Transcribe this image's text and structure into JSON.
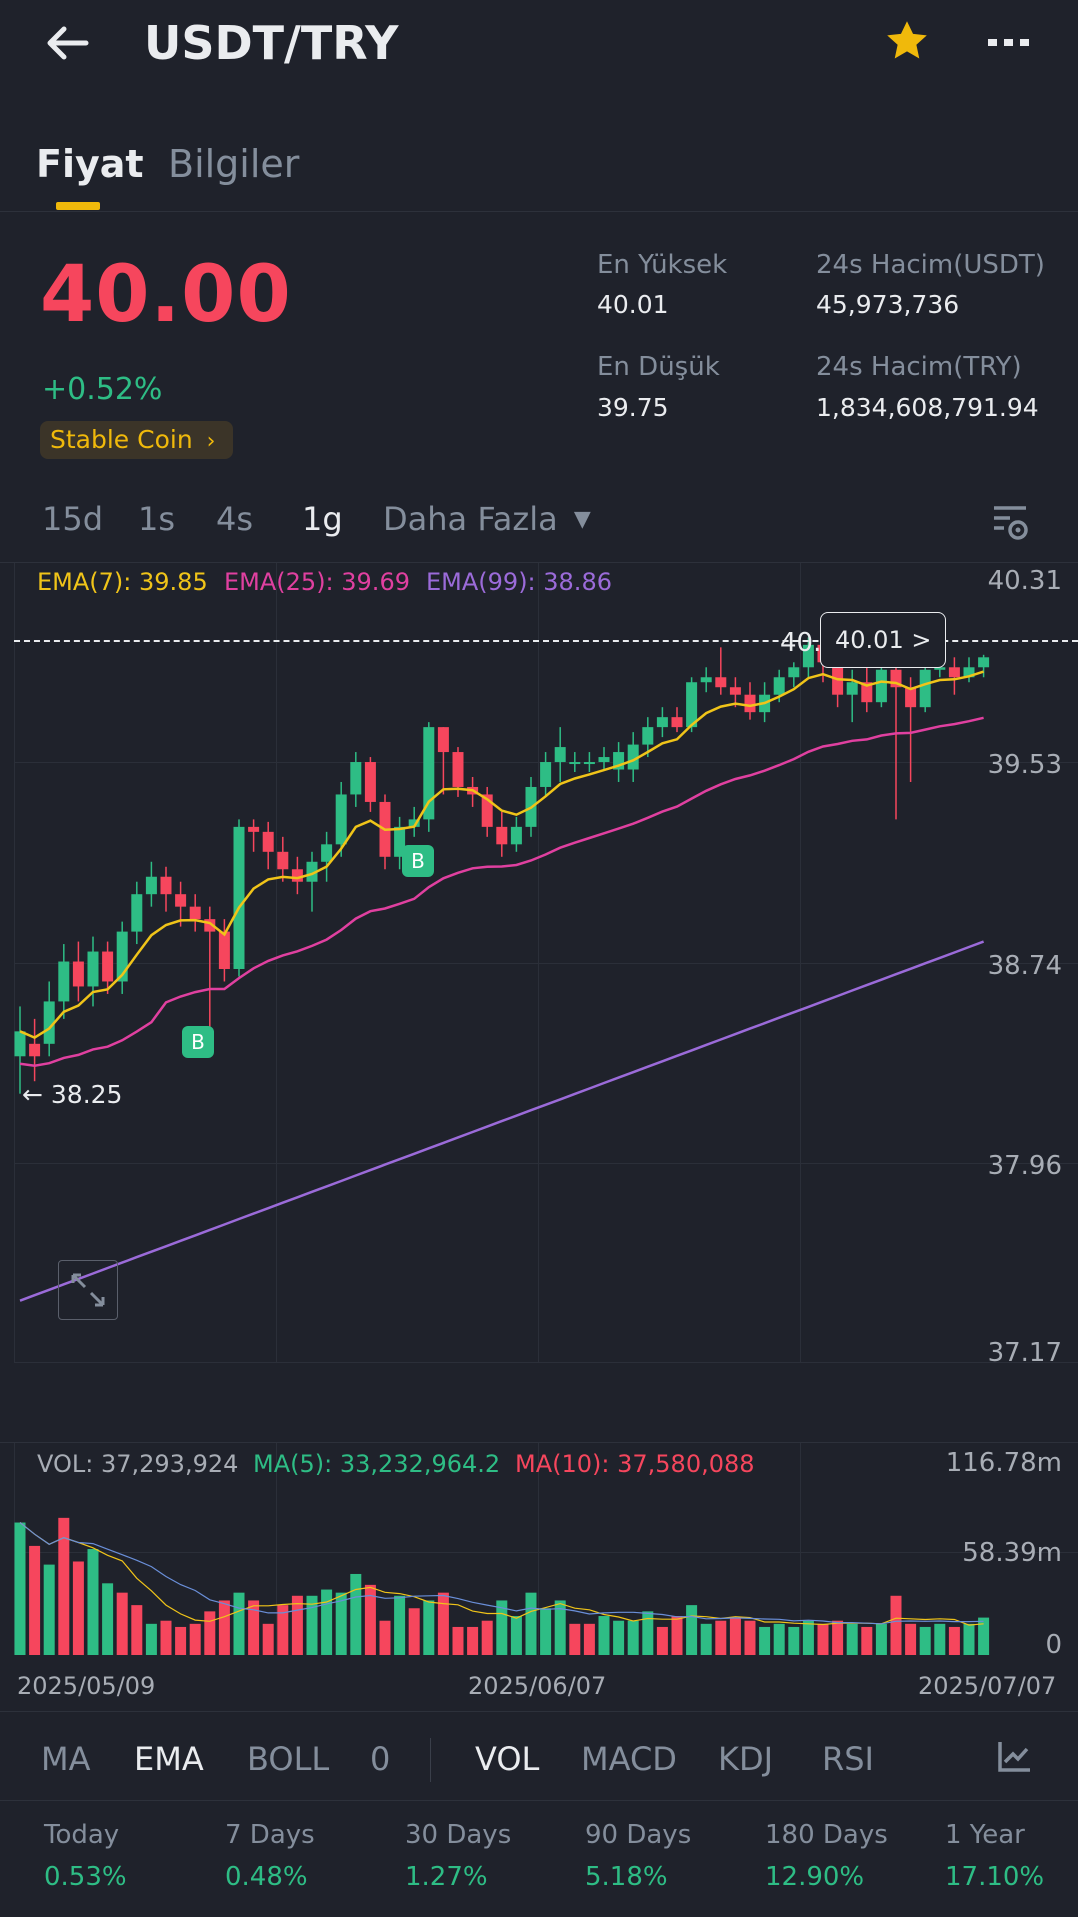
{
  "header": {
    "title": "USDT/TRY",
    "back_icon": "arrow-left-icon",
    "favorite_icon": "star-icon",
    "more_icon": "more-horizontal-icon",
    "favorite_color": "#f0b90b"
  },
  "tabs": [
    {
      "label": "Fiyat",
      "active": true
    },
    {
      "label": "Bilgiler",
      "active": false
    }
  ],
  "ticker": {
    "price": "40.00",
    "change": "+0.52%",
    "tag": "Stable Coin",
    "stats": {
      "high_label": "En Yüksek",
      "high": "40.01",
      "vol_usdt_label": "24s Hacim(USDT)",
      "vol_usdt": "45,973,736",
      "low_label": "En Düşük",
      "low": "39.75",
      "vol_try_label": "24s Hacim(TRY)",
      "vol_try": "1,834,608,791.94"
    }
  },
  "intervals": [
    {
      "label": "15d",
      "active": false
    },
    {
      "label": "1s",
      "active": false
    },
    {
      "label": "4s",
      "active": false
    },
    {
      "label": "1g",
      "active": true
    },
    {
      "label": "Daha Fazla",
      "active": false
    }
  ],
  "chart": {
    "ema7": "EMA(7): 39.85",
    "ema25": "EMA(25): 39.69",
    "ema99": "EMA(99): 38.86",
    "price_axis": [
      "40.31",
      "39.53",
      "38.74",
      "37.96",
      "37.17"
    ],
    "current_price_tag": "40.01 >",
    "current_price_partial": "40.",
    "low_marker": "← 38.25",
    "buy_marker": "B",
    "colors": {
      "up": "#2ebd85",
      "down": "#f6465d",
      "ema7": "#f0c419",
      "ema25": "#e040a0",
      "ema99": "#9b6bd9"
    }
  },
  "volume": {
    "vol": "VOL: 37,293,924",
    "ma5": "MA(5): 33,232,964.2",
    "ma10": "MA(10): 37,580,088",
    "axis": [
      "116.78m",
      "58.39m",
      "0"
    ]
  },
  "dates": [
    "2025/05/09",
    "2025/06/07",
    "2025/07/07"
  ],
  "indicators_main": [
    {
      "label": "MA",
      "active": false
    },
    {
      "label": "EMA",
      "active": true
    },
    {
      "label": "BOLL",
      "active": false
    },
    {
      "label": "0",
      "active": false
    }
  ],
  "indicators_sub": [
    {
      "label": "VOL",
      "active": true
    },
    {
      "label": "MACD",
      "active": false
    },
    {
      "label": "KDJ",
      "active": false
    },
    {
      "label": "RSI",
      "active": false
    }
  ],
  "performance": [
    {
      "label": "Today",
      "value": "0.53%"
    },
    {
      "label": "7 Days",
      "value": "0.48%"
    },
    {
      "label": "30 Days",
      "value": "1.27%"
    },
    {
      "label": "90 Days",
      "value": "5.18%"
    },
    {
      "label": "180 Days",
      "value": "12.90%"
    },
    {
      "label": "1 Year",
      "value": "17.10%"
    }
  ],
  "chart_data": {
    "type": "candlestick",
    "x_range": [
      "2025/05/09",
      "2025/07/07"
    ],
    "ylim": [
      37.17,
      40.31
    ],
    "candles": [
      {
        "o": 38.4,
        "c": 38.5,
        "h": 38.6,
        "l": 38.25
      },
      {
        "o": 38.45,
        "c": 38.4,
        "h": 38.55,
        "l": 38.3
      },
      {
        "o": 38.45,
        "c": 38.62,
        "h": 38.7,
        "l": 38.4
      },
      {
        "o": 38.62,
        "c": 38.78,
        "h": 38.85,
        "l": 38.55
      },
      {
        "o": 38.78,
        "c": 38.68,
        "h": 38.86,
        "l": 38.62
      },
      {
        "o": 38.68,
        "c": 38.82,
        "h": 38.88,
        "l": 38.6
      },
      {
        "o": 38.82,
        "c": 38.7,
        "h": 38.86,
        "l": 38.65
      },
      {
        "o": 38.7,
        "c": 38.9,
        "h": 38.94,
        "l": 38.65
      },
      {
        "o": 38.9,
        "c": 39.05,
        "h": 39.1,
        "l": 38.85
      },
      {
        "o": 39.05,
        "c": 39.12,
        "h": 39.18,
        "l": 39.0
      },
      {
        "o": 39.12,
        "c": 39.05,
        "h": 39.16,
        "l": 38.98
      },
      {
        "o": 39.05,
        "c": 39.0,
        "h": 39.1,
        "l": 38.92
      },
      {
        "o": 39.0,
        "c": 38.95,
        "h": 39.05,
        "l": 38.9
      },
      {
        "o": 38.95,
        "c": 38.9,
        "h": 39.0,
        "l": 38.45
      },
      {
        "o": 38.9,
        "c": 38.75,
        "h": 38.95,
        "l": 38.7
      },
      {
        "o": 38.75,
        "c": 39.32,
        "h": 39.35,
        "l": 38.72
      },
      {
        "o": 39.32,
        "c": 39.3,
        "h": 39.35,
        "l": 39.22
      },
      {
        "o": 39.3,
        "c": 39.22,
        "h": 39.34,
        "l": 39.15
      },
      {
        "o": 39.22,
        "c": 39.15,
        "h": 39.28,
        "l": 39.1
      },
      {
        "o": 39.15,
        "c": 39.1,
        "h": 39.2,
        "l": 39.05
      },
      {
        "o": 39.1,
        "c": 39.18,
        "h": 39.22,
        "l": 38.98
      },
      {
        "o": 39.18,
        "c": 39.25,
        "h": 39.3,
        "l": 39.1
      },
      {
        "o": 39.25,
        "c": 39.45,
        "h": 39.5,
        "l": 39.2
      },
      {
        "o": 39.45,
        "c": 39.58,
        "h": 39.62,
        "l": 39.4
      },
      {
        "o": 39.58,
        "c": 39.42,
        "h": 39.6,
        "l": 39.38
      },
      {
        "o": 39.42,
        "c": 39.2,
        "h": 39.45,
        "l": 39.15
      },
      {
        "o": 39.2,
        "c": 39.32,
        "h": 39.36,
        "l": 39.15
      },
      {
        "o": 39.32,
        "c": 39.35,
        "h": 39.4,
        "l": 39.28
      },
      {
        "o": 39.35,
        "c": 39.72,
        "h": 39.74,
        "l": 39.3
      },
      {
        "o": 39.72,
        "c": 39.62,
        "h": 39.72,
        "l": 39.45
      },
      {
        "o": 39.62,
        "c": 39.48,
        "h": 39.64,
        "l": 39.44
      },
      {
        "o": 39.48,
        "c": 39.45,
        "h": 39.52,
        "l": 39.4
      },
      {
        "o": 39.45,
        "c": 39.32,
        "h": 39.48,
        "l": 39.28
      },
      {
        "o": 39.32,
        "c": 39.25,
        "h": 39.38,
        "l": 39.2
      },
      {
        "o": 39.25,
        "c": 39.32,
        "h": 39.36,
        "l": 39.22
      },
      {
        "o": 39.32,
        "c": 39.48,
        "h": 39.52,
        "l": 39.28
      },
      {
        "o": 39.48,
        "c": 39.58,
        "h": 39.62,
        "l": 39.44
      },
      {
        "o": 39.58,
        "c": 39.64,
        "h": 39.72,
        "l": 39.5
      },
      {
        "o": 39.58,
        "c": 39.58,
        "h": 39.62,
        "l": 39.54
      },
      {
        "o": 39.58,
        "c": 39.58,
        "h": 39.62,
        "l": 39.54
      },
      {
        "o": 39.58,
        "c": 39.6,
        "h": 39.64,
        "l": 39.55
      },
      {
        "o": 39.55,
        "c": 39.62,
        "h": 39.66,
        "l": 39.5
      },
      {
        "o": 39.55,
        "c": 39.65,
        "h": 39.7,
        "l": 39.5
      },
      {
        "o": 39.65,
        "c": 39.72,
        "h": 39.76,
        "l": 39.6
      },
      {
        "o": 39.72,
        "c": 39.76,
        "h": 39.8,
        "l": 39.68
      },
      {
        "o": 39.76,
        "c": 39.72,
        "h": 39.8,
        "l": 39.7
      },
      {
        "o": 39.72,
        "c": 39.9,
        "h": 39.92,
        "l": 39.7
      },
      {
        "o": 39.9,
        "c": 39.92,
        "h": 39.96,
        "l": 39.86
      },
      {
        "o": 39.92,
        "c": 39.88,
        "h": 40.04,
        "l": 39.85
      },
      {
        "o": 39.88,
        "c": 39.85,
        "h": 39.92,
        "l": 39.8
      },
      {
        "o": 39.85,
        "c": 39.78,
        "h": 39.9,
        "l": 39.75
      },
      {
        "o": 39.78,
        "c": 39.85,
        "h": 39.9,
        "l": 39.74
      },
      {
        "o": 39.85,
        "c": 39.92,
        "h": 39.95,
        "l": 39.82
      },
      {
        "o": 39.92,
        "c": 39.96,
        "h": 39.98,
        "l": 39.88
      },
      {
        "o": 39.96,
        "c": 40.05,
        "h": 40.08,
        "l": 39.92
      },
      {
        "o": 40.05,
        "c": 39.98,
        "h": 40.08,
        "l": 39.9
      },
      {
        "o": 39.98,
        "c": 39.85,
        "h": 40.0,
        "l": 39.8
      },
      {
        "o": 39.85,
        "c": 39.9,
        "h": 39.95,
        "l": 39.74
      },
      {
        "o": 39.9,
        "c": 39.82,
        "h": 39.96,
        "l": 39.78
      },
      {
        "o": 39.82,
        "c": 39.95,
        "h": 40.01,
        "l": 39.8
      },
      {
        "o": 39.95,
        "c": 39.88,
        "h": 40.01,
        "l": 39.35
      },
      {
        "o": 39.88,
        "c": 39.8,
        "h": 39.92,
        "l": 39.5
      },
      {
        "o": 39.8,
        "c": 39.95,
        "h": 40.0,
        "l": 39.78
      },
      {
        "o": 39.95,
        "c": 39.96,
        "h": 40.0,
        "l": 39.92
      },
      {
        "o": 39.96,
        "c": 39.92,
        "h": 40.0,
        "l": 39.85
      },
      {
        "o": 39.92,
        "c": 39.96,
        "h": 40.0,
        "l": 39.9
      },
      {
        "o": 39.96,
        "c": 40.0,
        "h": 40.01,
        "l": 39.92
      }
    ],
    "volume_m": [
      85,
      70,
      58,
      88,
      60,
      68,
      46,
      40,
      32,
      20,
      22,
      18,
      20,
      28,
      35,
      40,
      35,
      20,
      32,
      38,
      38,
      42,
      40,
      52,
      45,
      22,
      38,
      30,
      35,
      40,
      18,
      18,
      22,
      35,
      25,
      40,
      30,
      35,
      20,
      20,
      25,
      22,
      22,
      28,
      18,
      25,
      32,
      20,
      22,
      24,
      22,
      18,
      20,
      18,
      22,
      20,
      22,
      20,
      18,
      20,
      38,
      20,
      18,
      20,
      18,
      20,
      24
    ],
    "volume_up": [
      true,
      false,
      true,
      false,
      false,
      true,
      true,
      false,
      false,
      true,
      false,
      false,
      false,
      false,
      false,
      true,
      false,
      false,
      false,
      false,
      true,
      true,
      true,
      true,
      false,
      false,
      true,
      false,
      true,
      false,
      false,
      false,
      false,
      true,
      true,
      true,
      true,
      true,
      false,
      false,
      true,
      true,
      true,
      true,
      false,
      false,
      true,
      true,
      false,
      false,
      false,
      true,
      true,
      true,
      true,
      false,
      false,
      true,
      false,
      true,
      false,
      false,
      true,
      true,
      false,
      true,
      true
    ]
  }
}
